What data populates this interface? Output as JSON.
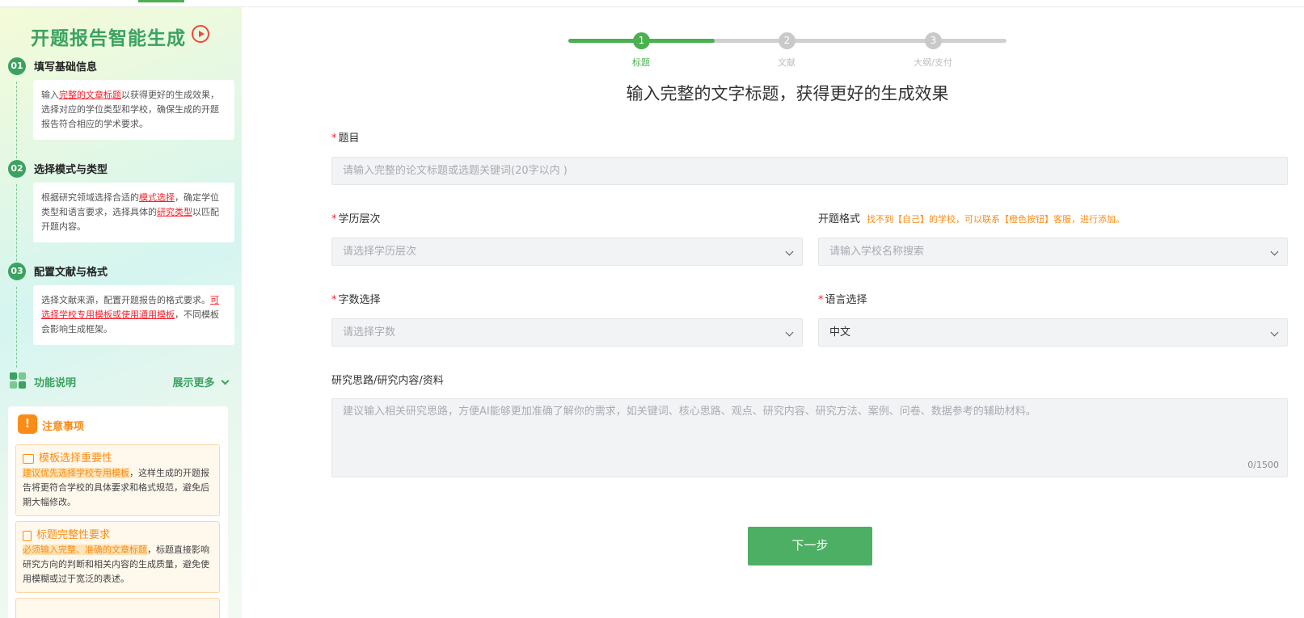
{
  "sidebar": {
    "title": "开题报告智能生成",
    "steps": [
      {
        "num": "01",
        "title": "填写基础信息",
        "text_a": "输入",
        "highlight": "完整的文章标题",
        "text_b": "以获得更好的生成效果，选择对应的学位类型和学校，确保生成的开题报告符合相应的学术要求。"
      },
      {
        "num": "02",
        "title": "选择模式与类型",
        "text_a": "根据研究领域选择合适的",
        "highlight": "模式选择",
        "text_b": "，确定学位类型和语言要求，选择具体的",
        "highlight2": "研究类型",
        "text_c": "以匹配开题内容。"
      },
      {
        "num": "03",
        "title": "配置文献与格式",
        "text_a": "选择文献来源，配置开题报告的格式要求。",
        "highlight": "可选择学校专用模板或使用通用模板",
        "text_b": "，不同模板会影响生成框架。"
      }
    ],
    "func_label": "功能说明",
    "func_more": "展示更多",
    "notice": {
      "icon": "!",
      "title": "注意事项",
      "cards": [
        {
          "title": "模板选择重要性",
          "highlight": "建议优先选择学校专用模板",
          "text": "，这样生成的开题报告将更符合学校的具体要求和格式规范，避免后期大幅修改。"
        },
        {
          "title": "标题完整性要求",
          "highlight": "必须输入完整、准确的文章标题",
          "text": "，标题直接影响研究方向的判断和相关内容的生成质量，避免使用模糊或过于宽泛的表述。"
        }
      ]
    }
  },
  "stepper": {
    "steps": [
      {
        "num": "1",
        "label": "标题"
      },
      {
        "num": "2",
        "label": "文献"
      },
      {
        "num": "3",
        "label": "大纲/支付"
      }
    ],
    "current": 1
  },
  "main": {
    "headline": "输入完整的文字标题，获得更好的生成效果",
    "required_mark": "*",
    "title_label": "题目",
    "title_placeholder": "请输入完整的论文标题或选题关键词(20字以内 )",
    "degree_label": "学历层次",
    "degree_placeholder": "请选择学历层次",
    "format_label": "开题格式",
    "format_hint": "找不到【自己】的学校，可以联系【橙色按钮】客服，进行添加。",
    "format_placeholder": "请输入学校名称搜索",
    "words_label": "字数选择",
    "words_placeholder": "请选择字数",
    "lang_label": "语言选择",
    "lang_value": "中文",
    "research_label": "研究思路/研究内容/资料",
    "research_placeholder": "建议输入相关研究思路，方便AI能够更加准确了解你的需求，如关键词、核心思路、观点、研究内容、研究方法、案例、问卷、数据参考的辅助材料。",
    "counter": "0/1500",
    "next_button": "下一步"
  }
}
